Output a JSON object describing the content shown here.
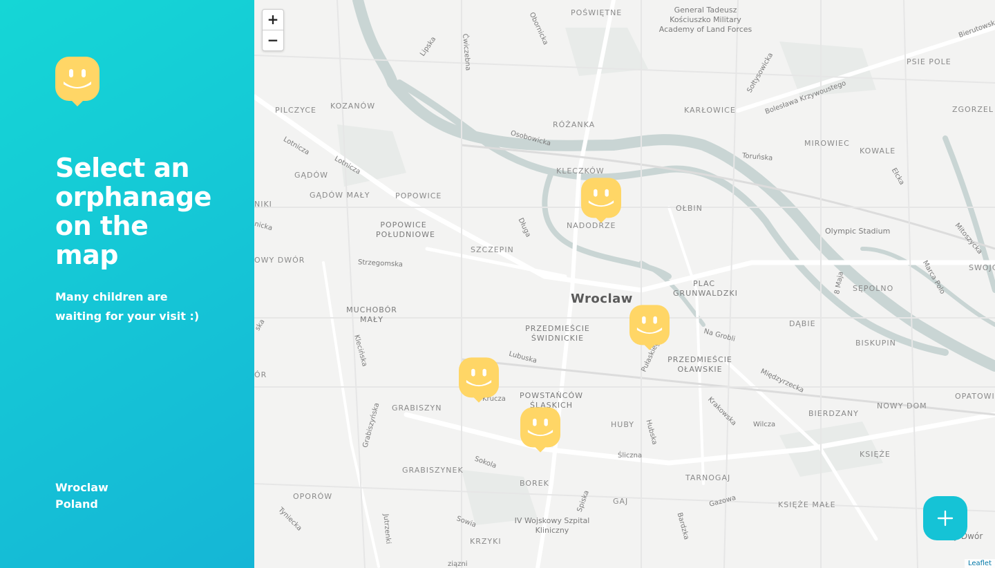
{
  "sidebar": {
    "logo_icon": "happy-marker-logo",
    "title": "Select an orphanage on the map",
    "subtitle": "Many children are waiting for your visit :)",
    "location_city": "Wroclaw",
    "location_state": "Poland"
  },
  "map": {
    "zoom_in_label": "+",
    "zoom_out_label": "−",
    "attribution": "Leaflet",
    "marker_icon": "happy-face-marker-icon",
    "marker_count": 4,
    "add_button_icon": "plus-icon",
    "labels": {
      "city": "Wroclaw",
      "academy": "General Tadeusz Kościuszko Military Academy of Land Forces",
      "stadium": "Olympic Stadium",
      "hospital": "IV Wojskowy Szpital Kliniczny",
      "poswietne": "POŚWIĘTNE",
      "psie_pole": "PSIE POLE",
      "zgorzel": "ZGORZEL",
      "karlowice": "KARŁOWICE",
      "mirowiec": "MIROWIEC",
      "kowale": "KOWALE",
      "rozanka": "RÓŻANKA",
      "kozanow": "KOZANÓW",
      "pilczyce": "PILCZYCE",
      "kleczkow": "KLECZKÓW",
      "gadow": "GĄDÓW",
      "gadow_maly": "GĄDÓW MAŁY",
      "popowice": "POPOWICE",
      "popowice_pol": "POPOWICE POŁUDNIOWE",
      "nadodrze": "NADODRZE",
      "olbin": "OŁBIN",
      "szczepin": "SZCZEPIN",
      "plac_grunwaldzki": "PLAC GRUNWALDZKI",
      "sepolno": "SĘPOLNO",
      "swojcz": "SWOJCZ",
      "dabie": "DĄBIE",
      "biskupin": "BISKUPIN",
      "muchobor": "MUCHOBÓR MAŁY",
      "przedm_swid": "PRZEDMIEŚCIE ŚWIDNICKIE",
      "przedm_olaw": "PRZEDMIEŚCIE OŁAWSKIE",
      "powstancow": "POWSTAŃCÓW ŚLĄSKICH",
      "grabiszyn": "GRABISZYN",
      "grabiszynek": "GRABISZYNEK",
      "huby": "HUBY",
      "borek": "BOREK",
      "tarnogaj": "TARNOGAJ",
      "gaj": "GAJ",
      "krzyki": "KRZYKI",
      "oporow": "OPORÓW",
      "bierdzany": "BIERDZANY",
      "ksieze": "KSIĘŻE",
      "ksieze_male": "KSIĘŻE MAŁE",
      "nowy_dom": "NOWY DOM",
      "opatowice": "OPATOWI",
      "niki": "NIKI",
      "owy_dwor": "OWY DWÓR",
      "or": "ÓR",
      "y_dwor": "y Dwór"
    },
    "streets": {
      "obornicka": "Obornicka",
      "lipska": "Lipska",
      "cwiczebna": "Ćwiczebna",
      "soltysowicka": "Sołtysowicka",
      "bolesl": "Bolesława Krzywoustego",
      "bierutowska": "Bierutowska",
      "osobowicka": "Osobowicka",
      "lotnicza1": "Lotnicza",
      "lotnicza2": "Lotnicza",
      "torunska": "Toruńska",
      "elcka": "Ełcka",
      "dluga": "Długa",
      "strzegomska": "Strzegomska",
      "milosz": "Mitoszycka",
      "maria": "Marca Polo",
      "maja": "8 Maja",
      "na_grobli": "Na Grobli",
      "pulaskiego": "Pułaskiego",
      "lubuska": "Lubuska",
      "klecinska": "Klecińska",
      "krucza": "Krucza",
      "grabiszynska": "Grabiszyńska",
      "miedzyrzecka": "Międzyrzecka",
      "krakowska": "Krakowska",
      "wilcza": "Wilcza",
      "hubska": "Hubska",
      "sliczna": "Śliczna",
      "sokola": "Sokola",
      "spiska": "Spiska",
      "gazowa": "Gazowa",
      "bardzka": "Bardzka",
      "sowia": "Sowia",
      "jutrzenki": "Jutrzenki",
      "tyniecka": "Tyniecka",
      "ska": "ska",
      "nicka": "nicka",
      "ziazni": "ziązni"
    }
  }
}
